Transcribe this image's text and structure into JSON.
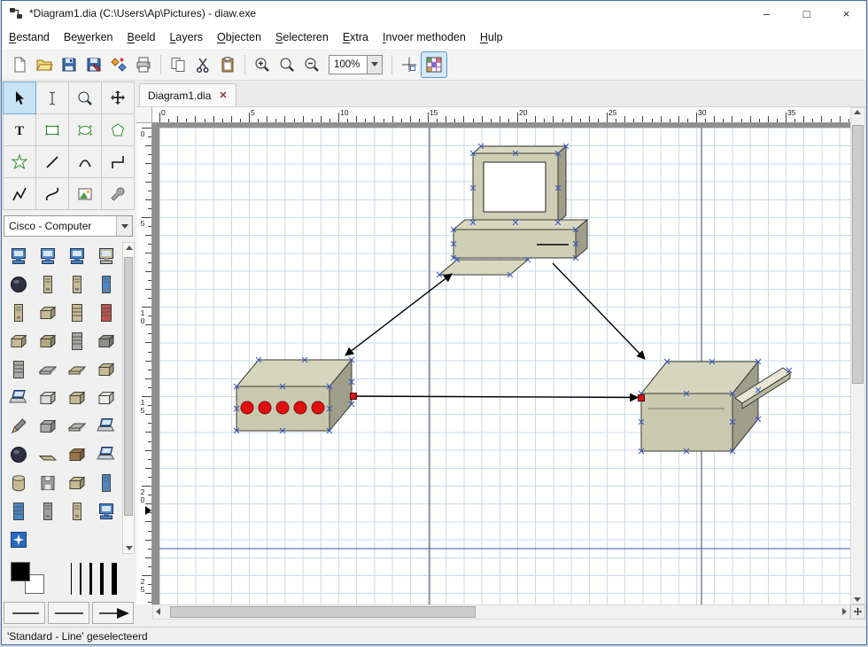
{
  "window": {
    "title": "*Diagram1.dia (C:\\Users\\Ap\\Pictures) - diaw.exe",
    "controls": {
      "minimize": "–",
      "maximize": "□",
      "close": "×"
    }
  },
  "menu": {
    "items": [
      {
        "id": "bestand",
        "label": "Bestand",
        "u": 0
      },
      {
        "id": "bewerken",
        "label": "Bewerken",
        "u": 2
      },
      {
        "id": "beeld",
        "label": "Beeld",
        "u": 0
      },
      {
        "id": "layers",
        "label": "Layers",
        "u": 0
      },
      {
        "id": "objecten",
        "label": "Objecten",
        "u": 0
      },
      {
        "id": "selecteren",
        "label": "Selecteren",
        "u": 0
      },
      {
        "id": "extra",
        "label": "Extra",
        "u": 0
      },
      {
        "id": "invoer_methoden",
        "label": "Invoer methoden",
        "u": 0
      },
      {
        "id": "hulp",
        "label": "Hulp",
        "u": 0
      }
    ]
  },
  "toolbar": {
    "zoom_value": "100%"
  },
  "tabbar": {
    "active_tab": "Diagram1.dia",
    "close_glyph": "✕"
  },
  "toolbox": {
    "sheet_selected": "Cisco - Computer"
  },
  "rulers": {
    "horizontal_labels": [
      "0",
      "5",
      "10",
      "15",
      "20",
      "25",
      "30",
      "35"
    ],
    "vertical_labels": [
      "0",
      "5",
      "10",
      "15",
      "20",
      "25"
    ]
  },
  "palette": {
    "icons": [
      "pc:#4a86c8",
      "pc:#5b8fd0",
      "pc:#4a86c8",
      "pc:#c6ba94",
      "disk:#2f2f44",
      "tower:#c6ba94",
      "tower:#c6ba94",
      "tower:#4a86c8",
      "tower:#c6ba94",
      "box:#c6ba94",
      "cab:#c6ba94",
      "cab:#c05050",
      "box:#c6ba94",
      "box:#b2a884",
      "cab:#a9a9a9",
      "box:#8f8f8f",
      "cab:#a9a9a9",
      "flat:#b5b5b5",
      "flat:#c6ba94",
      "box:#c6ba94",
      "laptop:#4a86c8",
      "box:#dcdcdc",
      "box:#c6ba94",
      "box:#ececec",
      "pen:#8a8a8a",
      "box:#a9a9a9",
      "flat:#b5b5b5",
      "laptop:#4a86c8",
      "disk:#2f2f44",
      "kbd:#c6ba94",
      "box:#9a7448",
      "laptop:#4a86c8",
      "cyl:#c6ba94",
      "floppy:#9f9f9f",
      "box:#c6ba94",
      "tower:#4a86c8",
      "cab:#4a86c8",
      "tower:#a0a0a0",
      "tower:#c6ba94",
      "pc:#4a86c8",
      "sparkle:#2a6ac0"
    ]
  },
  "diagram": {
    "objects": [
      {
        "name": "computer"
      },
      {
        "name": "server-with-leds"
      },
      {
        "name": "printer"
      }
    ],
    "selected_object": "Standard - Line"
  },
  "statusbar": {
    "text": "'Standard - Line' geselecteerd"
  }
}
